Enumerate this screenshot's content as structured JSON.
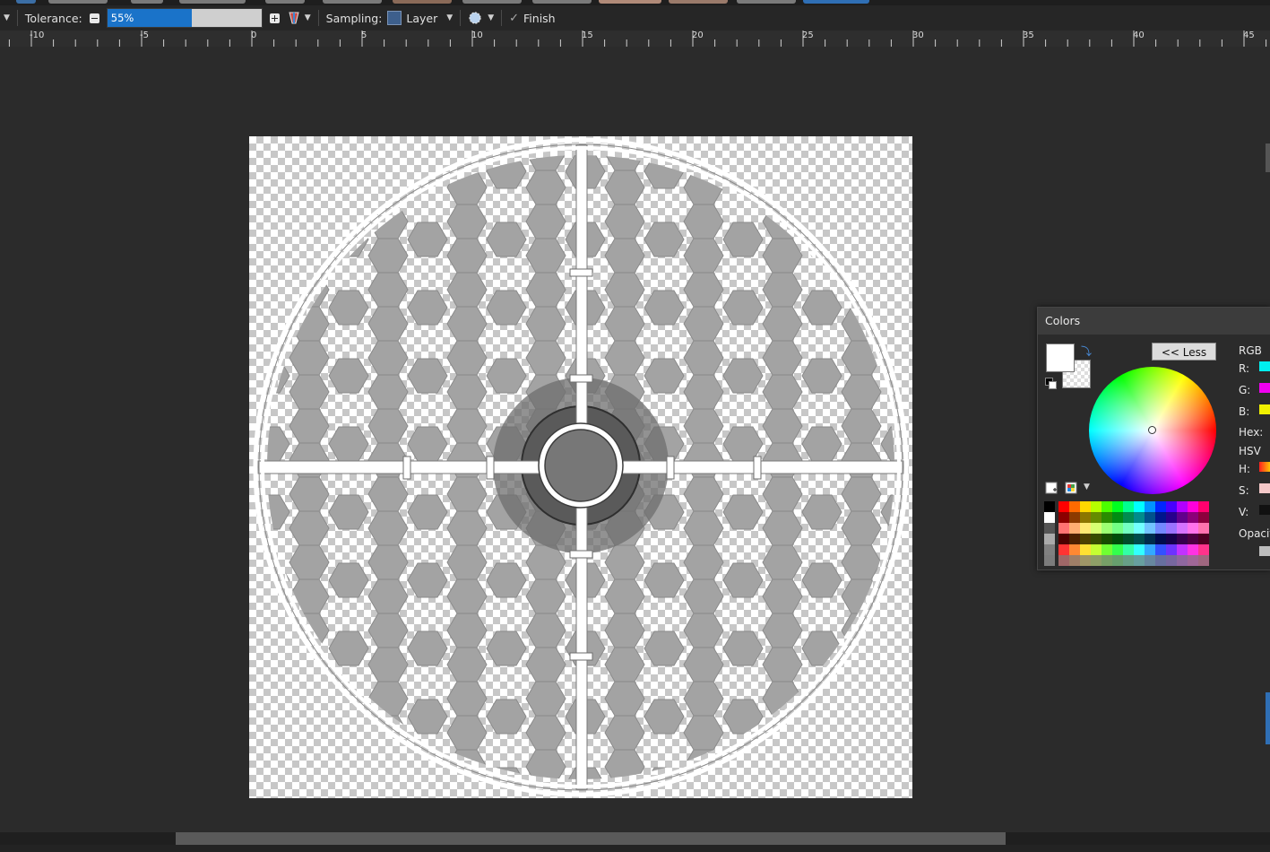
{
  "toolbar": {
    "tolerance_label": "Tolerance:",
    "tolerance_value": "55%",
    "tolerance_fraction": 0.55,
    "sampling_label": "Sampling:",
    "sampling_value": "Layer",
    "finish_label": "Finish"
  },
  "ruler": {
    "labels": [
      "-10",
      "-5",
      "0",
      "5",
      "10",
      "15",
      "20",
      "25",
      "30",
      "35",
      "40",
      "45"
    ]
  },
  "colors_panel": {
    "title": "Colors",
    "less_button": "<< Less",
    "rgb_header": "RGB",
    "r_label": "R:",
    "g_label": "G:",
    "b_label": "B:",
    "hex_label": "Hex:",
    "hsv_header": "HSV",
    "h_label": "H:",
    "s_label": "S:",
    "v_label": "V:",
    "opacity_label": "Opacity",
    "primary_color": "#ffffff",
    "palette_top_row": [
      "#000000",
      "#ff0000",
      "#ff6a00",
      "#ffd800",
      "#b6ff00",
      "#4cff00",
      "#00ff21",
      "#00ff90",
      "#00ffff",
      "#0094ff",
      "#0026ff",
      "#4800ff",
      "#b200ff",
      "#ff00dc",
      "#ff006e"
    ]
  },
  "icons": [
    "collapse-caret-icon",
    "tolerance-decrease-icon",
    "tolerance-increase-icon",
    "flood-mode-icon",
    "sampling-layer-swatch-icon",
    "antialias-icon",
    "checkmark-icon",
    "swap-colors-icon",
    "reset-colors-icon",
    "add-to-palette-icon",
    "palette-menu-icon"
  ]
}
